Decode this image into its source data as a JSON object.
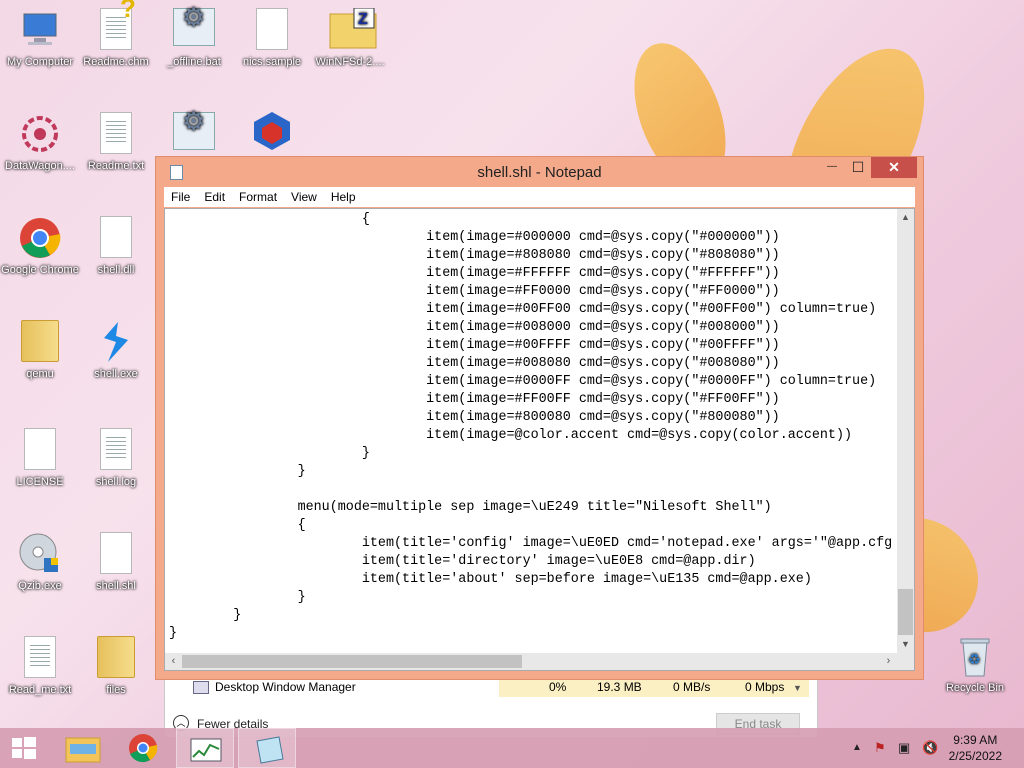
{
  "desktop": {
    "icons": [
      {
        "label": "My Computer",
        "icon": "computer-icon"
      },
      {
        "label": "Readme.chm",
        "icon": "help-file-icon"
      },
      {
        "label": "_offline.bat",
        "icon": "batch-file-icon"
      },
      {
        "label": "nics.sample",
        "icon": "document-icon"
      },
      {
        "label": "WinNFSd-2....",
        "icon": "zip-folder-icon"
      },
      {
        "label": "DataWagon....",
        "icon": "app-shortcut-icon"
      },
      {
        "label": "Readme.txt",
        "icon": "text-file-icon"
      },
      {
        "label": "Google Chrome",
        "icon": "chrome-icon"
      },
      {
        "label": "shell.dll",
        "icon": "dll-file-icon"
      },
      {
        "label": "qemu",
        "icon": "folder-icon"
      },
      {
        "label": "shell.exe",
        "icon": "shell-exe-icon"
      },
      {
        "label": "LICENSE",
        "icon": "document-icon"
      },
      {
        "label": "shell.log",
        "icon": "text-file-icon"
      },
      {
        "label": "Qzib.exe",
        "icon": "disc-installer-icon"
      },
      {
        "label": "shell.shl",
        "icon": "document-icon"
      },
      {
        "label": "Read_me.txt",
        "icon": "text-file-icon"
      },
      {
        "label": "files",
        "icon": "folder-icon"
      },
      {
        "label": "Recycle Bin",
        "icon": "recycle-bin-icon"
      }
    ]
  },
  "taskmanager": {
    "process": "Desktop Window Manager",
    "cpu": "0%",
    "memory": "19.3 MB",
    "disk": "0 MB/s",
    "network": "0 Mbps",
    "fewer_details": "Fewer details",
    "end_task": "End task"
  },
  "notepad": {
    "title": "shell.shl - Notepad",
    "window_buttons": {
      "minimize": "—",
      "maximize": "☐",
      "close": "✕"
    },
    "menu": [
      "File",
      "Edit",
      "Format",
      "View",
      "Help"
    ],
    "content": "                        {\n                                item(image=#000000 cmd=@sys.copy(\"#000000\"))\n                                item(image=#808080 cmd=@sys.copy(\"#808080\"))\n                                item(image=#FFFFFF cmd=@sys.copy(\"#FFFFFF\"))\n                                item(image=#FF0000 cmd=@sys.copy(\"#FF0000\"))\n                                item(image=#00FF00 cmd=@sys.copy(\"#00FF00\") column=true)\n                                item(image=#008000 cmd=@sys.copy(\"#008000\"))\n                                item(image=#00FFFF cmd=@sys.copy(\"#00FFFF\"))\n                                item(image=#008080 cmd=@sys.copy(\"#008080\"))\n                                item(image=#0000FF cmd=@sys.copy(\"#0000FF\") column=true)\n                                item(image=#FF00FF cmd=@sys.copy(\"#FF00FF\"))\n                                item(image=#800080 cmd=@sys.copy(\"#800080\"))\n                                item(image=@color.accent cmd=@sys.copy(color.accent))\n                        }\n                }\n\n                menu(mode=multiple sep image=\\uE249 title=\"Nilesoft Shell\")\n                {\n                        item(title='config' image=\\uE0ED cmd='notepad.exe' args='\"@app.cfg\n                        item(title='directory' image=\\uE0E8 cmd=@app.dir)\n                        item(title='about' sep=before image=\\uE135 cmd=@app.exe)\n                }\n        }\n}"
  },
  "taskbar": {
    "time": "9:39 AM",
    "date": "2/25/2022"
  },
  "colors": {
    "accent": "#f3a98a",
    "close": "#c7504b",
    "taskbar": "#d69db2"
  }
}
